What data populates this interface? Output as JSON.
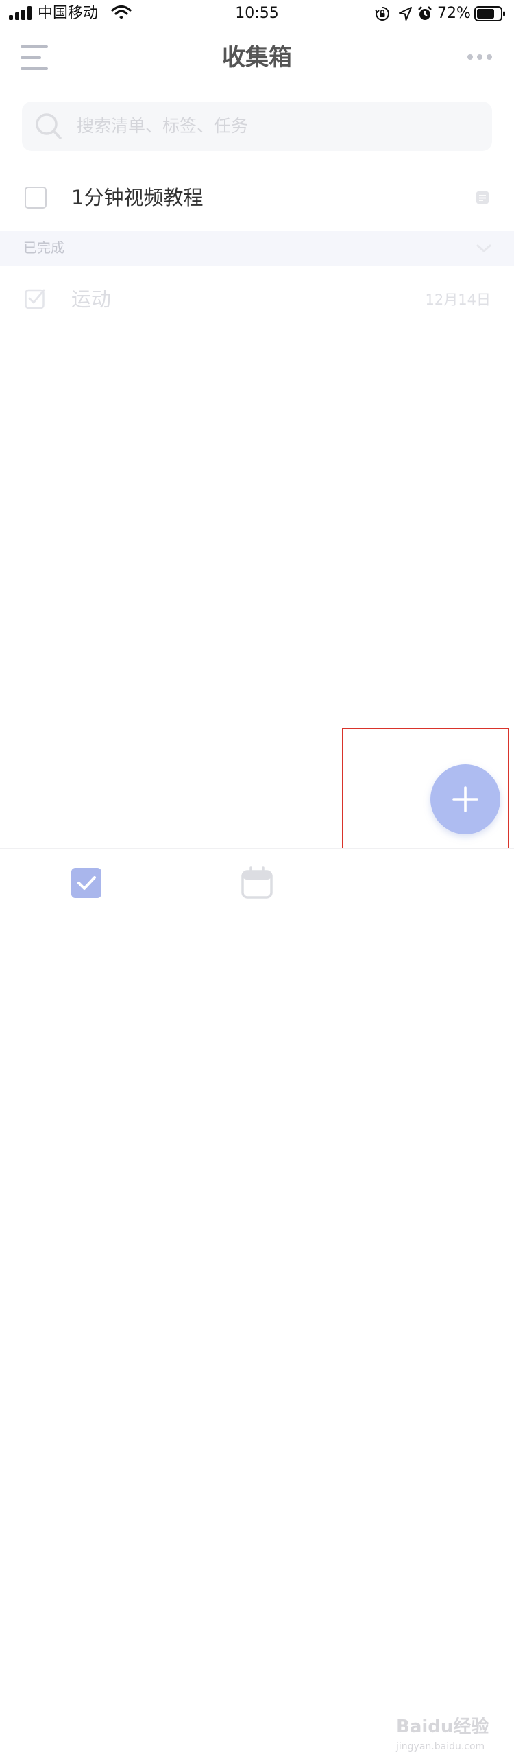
{
  "status_bar": {
    "carrier": "中国移动",
    "time": "10:55",
    "battery_percent": "72%",
    "icons": [
      "signal-icon",
      "wifi-icon",
      "rotation-lock-icon",
      "location-icon",
      "alarm-icon",
      "battery-icon"
    ]
  },
  "header": {
    "title": "收集箱",
    "left_icon": "menu-icon",
    "right_icon": "more-icon"
  },
  "search": {
    "placeholder": "搜索清单、标签、任务",
    "icon": "search-icon"
  },
  "tasks": [
    {
      "title": "1分钟视频教程",
      "checked": false,
      "icon": "note-icon"
    }
  ],
  "completed_section": {
    "label": "已完成",
    "icon": "chevron-down-icon",
    "items": [
      {
        "title": "运动",
        "checked": true,
        "date": "12月14日"
      }
    ]
  },
  "fab": {
    "icon": "plus-icon",
    "highlight_color": "#d9342b",
    "color": "#aebcf1"
  },
  "tab_bar": {
    "tabs": [
      {
        "icon": "task-check-icon",
        "active": true
      },
      {
        "icon": "calendar-icon",
        "active": false
      }
    ]
  },
  "watermark": {
    "brand": "Baidu经验",
    "url": "jingyan.baidu.com"
  },
  "colors": {
    "accent": "#aebcf1",
    "tab_active": "#a9b6ec",
    "section_bg": "#f5f6fb"
  }
}
